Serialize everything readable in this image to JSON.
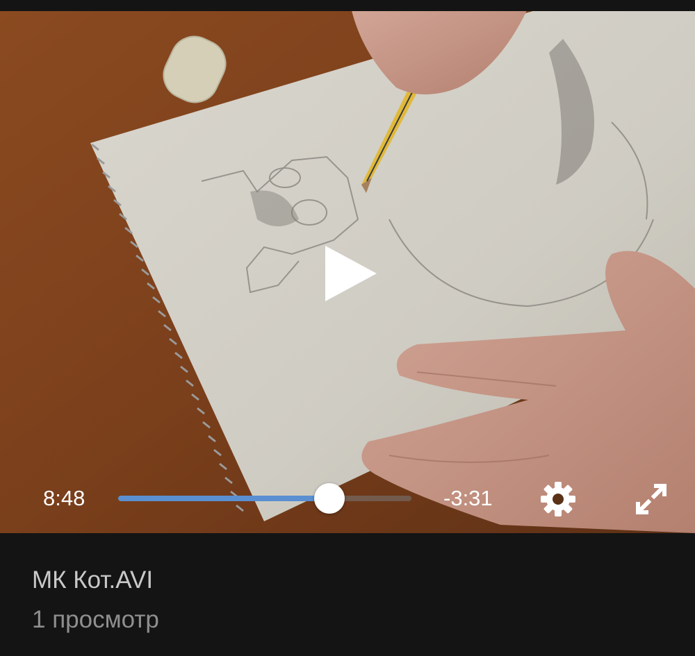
{
  "player": {
    "elapsed": "8:48",
    "remaining": "-3:31",
    "progress_fraction": 0.72,
    "accent_color": "#5a8fd1",
    "icons": {
      "play": "play-icon",
      "settings": "gear-icon",
      "fullscreen": "fullscreen-expand-icon"
    }
  },
  "video": {
    "title": "МК Кот.AVI",
    "views": "1 просмотр"
  }
}
